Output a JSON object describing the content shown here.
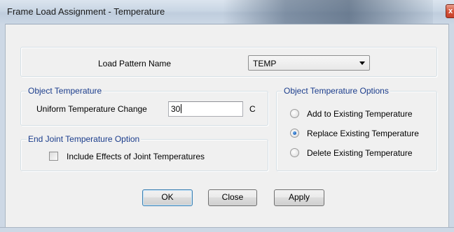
{
  "window": {
    "title": "Frame Load Assignment - Temperature",
    "close_glyph": "x"
  },
  "load_pattern": {
    "label": "Load Pattern Name",
    "selected": "TEMP"
  },
  "object_temperature": {
    "legend": "Object Temperature",
    "field_label": "Uniform Temperature Change",
    "value": "30",
    "unit": "C"
  },
  "end_joint": {
    "legend": "End Joint Temperature Option",
    "checkbox_label": "Include Effects of Joint Temperatures",
    "checked": false
  },
  "options": {
    "legend": "Object Temperature Options",
    "items": [
      {
        "label": "Add to Existing Temperature",
        "checked": false
      },
      {
        "label": "Replace Existing Temperature",
        "checked": true
      },
      {
        "label": "Delete Existing Temperature",
        "checked": false
      }
    ]
  },
  "buttons": {
    "ok": "OK",
    "close": "Close",
    "apply": "Apply"
  },
  "icons": {
    "dropdown": "chevron-down-icon",
    "close": "close-icon"
  }
}
